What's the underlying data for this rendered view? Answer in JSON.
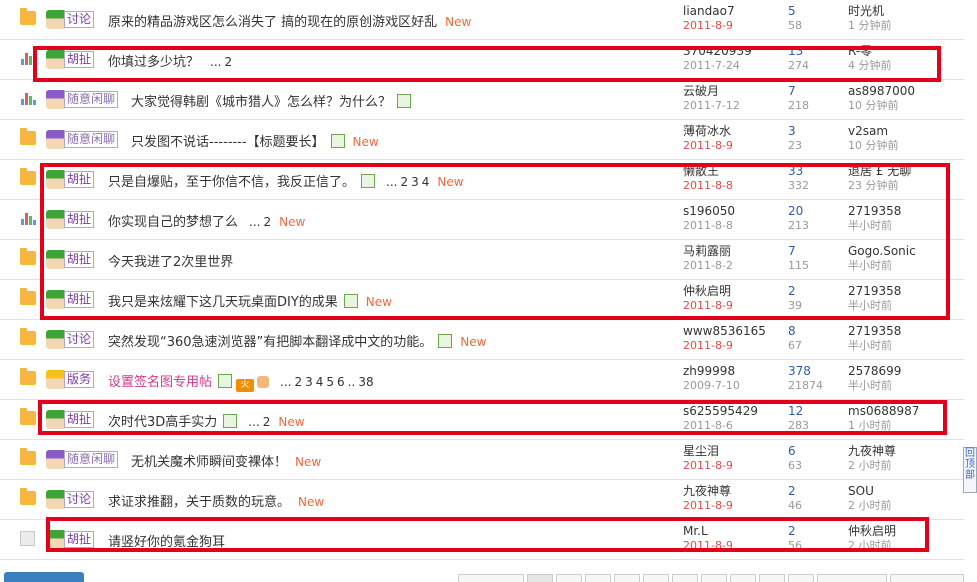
{
  "threads": [
    {
      "icon": "folder-icon",
      "avatar": "green",
      "tag": "讨论",
      "title": "原来的精品游戏区怎么消失了 搞的现在的原创游戏区好乱",
      "img": false,
      "pages": [],
      "new": "New",
      "author": "liandao7",
      "date": "2011-8-9",
      "date_red": true,
      "replies": "5",
      "views": "58",
      "last_user": "时光机",
      "last_time": "1 分钟前"
    },
    {
      "icon": "bar-chart-icon",
      "avatar": "green",
      "tag": "胡扯",
      "title": "你填过多少坑？",
      "img": false,
      "pages": [
        "...",
        "2"
      ],
      "new": "",
      "author": "370420939",
      "date": "2011-7-24",
      "date_red": false,
      "replies": "13",
      "views": "274",
      "last_user": "R-零",
      "last_time": "4 分钟前"
    },
    {
      "icon": "bar-chart-icon",
      "avatar": "purple",
      "tag": "随意闲聊",
      "title": "大家觉得韩剧《城市猎人》怎么样？为什么？",
      "img": true,
      "pages": [],
      "new": "",
      "author": "云破月",
      "date": "2011-7-12",
      "date_red": false,
      "replies": "7",
      "views": "218",
      "last_user": "as8987000",
      "last_time": "10 分钟前"
    },
    {
      "icon": "folder-icon",
      "avatar": "purple",
      "tag": "随意闲聊",
      "title": "只发图不说话--------【标题要长】",
      "img": true,
      "pages": [],
      "new": "New",
      "author": "薄荷冰水",
      "date": "2011-8-9",
      "date_red": true,
      "replies": "3",
      "views": "23",
      "last_user": "v2sam",
      "last_time": "10 分钟前"
    },
    {
      "icon": "folder-icon",
      "avatar": "green",
      "tag": "胡扯",
      "title": "只是自爆贴，至于你信不信，我反正信了。",
      "img": true,
      "pages": [
        "...",
        "2",
        "3",
        "4"
      ],
      "new": "New",
      "author": "懒散王",
      "date": "2011-8-8",
      "date_red": true,
      "replies": "33",
      "views": "332",
      "last_user": "退居 £ 无聊",
      "last_time": "23 分钟前"
    },
    {
      "icon": "bar-chart-icon",
      "avatar": "green",
      "tag": "胡扯",
      "title": "你实现自己的梦想了么",
      "img": false,
      "pages": [
        "...",
        "2"
      ],
      "new": "New",
      "author": "s196050",
      "date": "2011-8-8",
      "date_red": false,
      "replies": "20",
      "views": "213",
      "last_user": "2719358",
      "last_time": "半小时前"
    },
    {
      "icon": "folder-icon",
      "avatar": "green",
      "tag": "胡扯",
      "title": "今天我进了2次里世界",
      "img": false,
      "pages": [],
      "new": "",
      "author": "马莉露丽",
      "date": "2011-8-2",
      "date_red": false,
      "replies": "7",
      "views": "115",
      "last_user": "Gogo.Sonic",
      "last_time": "半小时前"
    },
    {
      "icon": "folder-icon",
      "avatar": "green",
      "tag": "胡扯",
      "title": "我只是来炫耀下这几天玩桌面DIY的成果",
      "img": true,
      "pages": [],
      "new": "New",
      "author": "仲秋启明",
      "date": "2011-8-9",
      "date_red": true,
      "replies": "2",
      "views": "39",
      "last_user": "2719358",
      "last_time": "半小时前"
    },
    {
      "icon": "folder-icon",
      "avatar": "green",
      "tag": "讨论",
      "title": "突然发现“360急速浏览器”有把脚本翻译成中文的功能。",
      "img": true,
      "pages": [],
      "new": "New",
      "author": "www8536165",
      "date": "2011-8-9",
      "date_red": true,
      "replies": "8",
      "views": "67",
      "last_user": "2719358",
      "last_time": "半小时前"
    },
    {
      "icon": "folder-icon",
      "avatar": "yellow",
      "tag": "版务",
      "title": "设置签名图专用帖",
      "pink": true,
      "img": true,
      "hot": "火",
      "thumb": true,
      "pages": [
        "...",
        "2",
        "3",
        "4",
        "5",
        "6",
        "..",
        "38"
      ],
      "new": "",
      "author": "zh99998",
      "date": "2009-7-10",
      "date_red": false,
      "replies": "378",
      "views": "21874",
      "last_user": "2578699",
      "last_time": "半小时前"
    },
    {
      "icon": "folder-icon",
      "avatar": "green",
      "tag": "胡扯",
      "title": "次时代3D高手实力",
      "img": true,
      "pages": [
        "...",
        "2"
      ],
      "new": "New",
      "author": "s625595429",
      "date": "2011-8-6",
      "date_red": false,
      "replies": "12",
      "views": "283",
      "last_user": "ms0688987",
      "last_time": "1 小时前"
    },
    {
      "icon": "folder-icon",
      "avatar": "purple",
      "tag": "随意闲聊",
      "title": "无机关魔术师瞬间变裸体！",
      "img": false,
      "pages": [],
      "new": "New",
      "author": "星尘泪",
      "date": "2011-8-9",
      "date_red": true,
      "replies": "6",
      "views": "63",
      "last_user": "九夜神尊",
      "last_time": "2 小时前"
    },
    {
      "icon": "folder-icon",
      "avatar": "green",
      "tag": "讨论",
      "title": "求证求推翻，关于质数的玩意。",
      "img": false,
      "pages": [],
      "new": "New",
      "author": "九夜神尊",
      "date": "2011-8-9",
      "date_red": true,
      "replies": "2",
      "views": "46",
      "last_user": "SOU",
      "last_time": "2 小时前"
    },
    {
      "icon": "document-icon",
      "avatar": "green",
      "tag": "胡扯",
      "title": "请竖好你的氪金狗耳",
      "img": false,
      "pages": [],
      "new": "",
      "author": "Mr.L",
      "date": "2011-8-9",
      "date_red": true,
      "replies": "2",
      "views": "56",
      "last_user": "仲秋启明",
      "last_time": "2 小时前"
    }
  ],
  "scroll_widget": "回顶部",
  "colors": {
    "highlight": "#e3001b",
    "new": "#ef6a3f",
    "link": "#2a5fa8",
    "date_red": "#e04b4b"
  }
}
